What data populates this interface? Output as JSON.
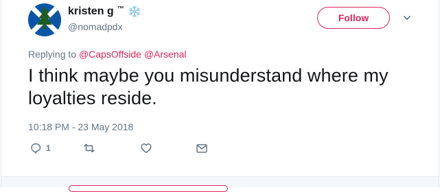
{
  "user": {
    "display_name": "kristen g",
    "tm": "™",
    "handle": "@nomadpdx",
    "avatar_icon": "scottish-saltire-flag-with-tree"
  },
  "follow": {
    "label": "Follow"
  },
  "reply_context": {
    "prefix": "Replying to",
    "mentions": [
      "@CapsOffside",
      "@Arsenal"
    ]
  },
  "tweet": {
    "text": "I think maybe you misunderstand where my loyalties reside.",
    "timestamp": "10:18 PM - 23 May 2018"
  },
  "actions": {
    "reply_count": "1",
    "icons": [
      "reply-icon",
      "retweet-icon",
      "like-icon",
      "message-icon"
    ]
  },
  "colors": {
    "accent": "#e0245e",
    "muted": "#657786",
    "text": "#14171a"
  }
}
